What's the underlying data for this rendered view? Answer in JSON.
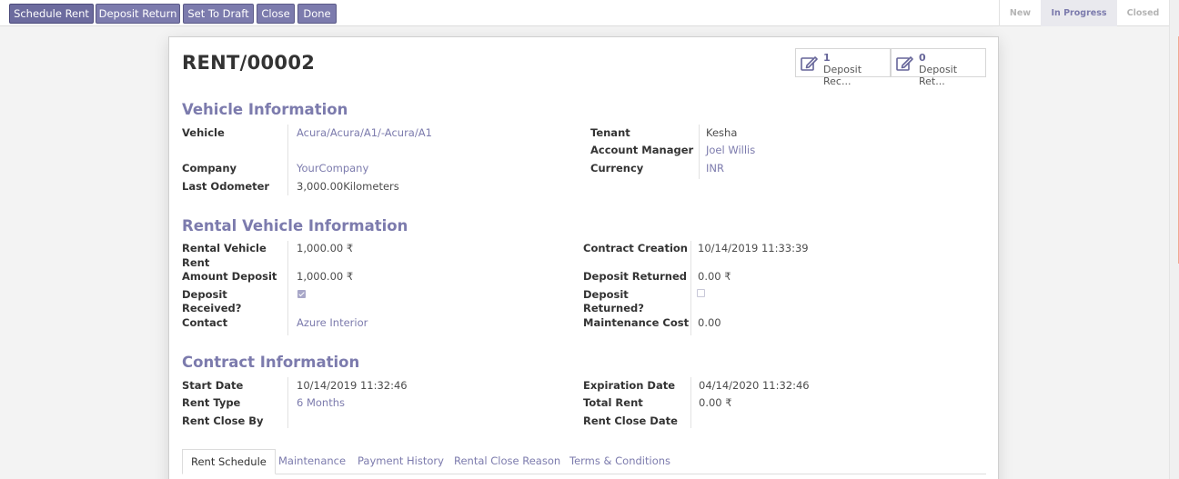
{
  "statusbar": {
    "buttons": [
      "Schedule Rent",
      "Deposit Return",
      "Set To Draft",
      "Close",
      "Done"
    ],
    "stages": [
      "New",
      "In Progress",
      "Closed"
    ],
    "current_stage": "In Progress"
  },
  "record": {
    "title": "RENT/00002"
  },
  "smart_buttons": [
    {
      "count": "1",
      "label": "Deposit Rec...",
      "icon": "edit-icon"
    },
    {
      "count": "0",
      "label": "Deposit Ret...",
      "icon": "edit-icon"
    }
  ],
  "vehicle_info": {
    "heading": "Vehicle Information",
    "vehicle_label": "Vehicle",
    "vehicle_value": "Acura/Acura/A1/-Acura/A1",
    "company_label": "Company",
    "company_value": "YourCompany",
    "odometer_label": "Last Odometer",
    "odometer_value": "3,000.00Kilometers",
    "tenant_label": "Tenant",
    "tenant_value": "Kesha",
    "manager_label": "Account Manager",
    "manager_value": "Joel Willis",
    "currency_label": "Currency",
    "currency_value": "INR"
  },
  "rental_info": {
    "heading": "Rental Vehicle Information",
    "rent_label_1": "Rental Vehicle",
    "rent_label_2": "Rent",
    "rent_value": "1,000.00 ₹",
    "deposit_label": "Amount Deposit",
    "deposit_value": "1,000.00 ₹",
    "received_label_1": "Deposit",
    "received_label_2": "Received?",
    "received_checked": true,
    "contact_label": "Contact",
    "contact_value": "Azure Interior",
    "creation_label": "Contract Creation",
    "creation_value": "10/14/2019 11:33:39",
    "returned_amt_label": "Deposit Returned",
    "returned_amt_value": "0.00 ₹",
    "returned_label_1": "Deposit",
    "returned_label_2": "Returned?",
    "returned_checked": false,
    "maintenance_label": "Maintenance Cost",
    "maintenance_value": "0.00"
  },
  "contract_info": {
    "heading": "Contract Information",
    "start_label": "Start Date",
    "start_value": "10/14/2019 11:32:46",
    "type_label": "Rent Type",
    "type_value": "6 Months",
    "closeby_label": "Rent Close By",
    "closeby_value": "",
    "expiration_label": "Expiration Date",
    "expiration_value": "04/14/2020 11:32:46",
    "total_label": "Total Rent",
    "total_value": "0.00 ₹",
    "closedate_label": "Rent Close Date",
    "closedate_value": ""
  },
  "tabs": [
    "Rent Schedule",
    "Maintenance",
    "Payment History",
    "Rental Close Reason",
    "Terms & Conditions"
  ],
  "active_tab": "Rent Schedule",
  "colors": {
    "accent": "#7c7bad",
    "button": "#7c7bad",
    "title": "#333333"
  }
}
